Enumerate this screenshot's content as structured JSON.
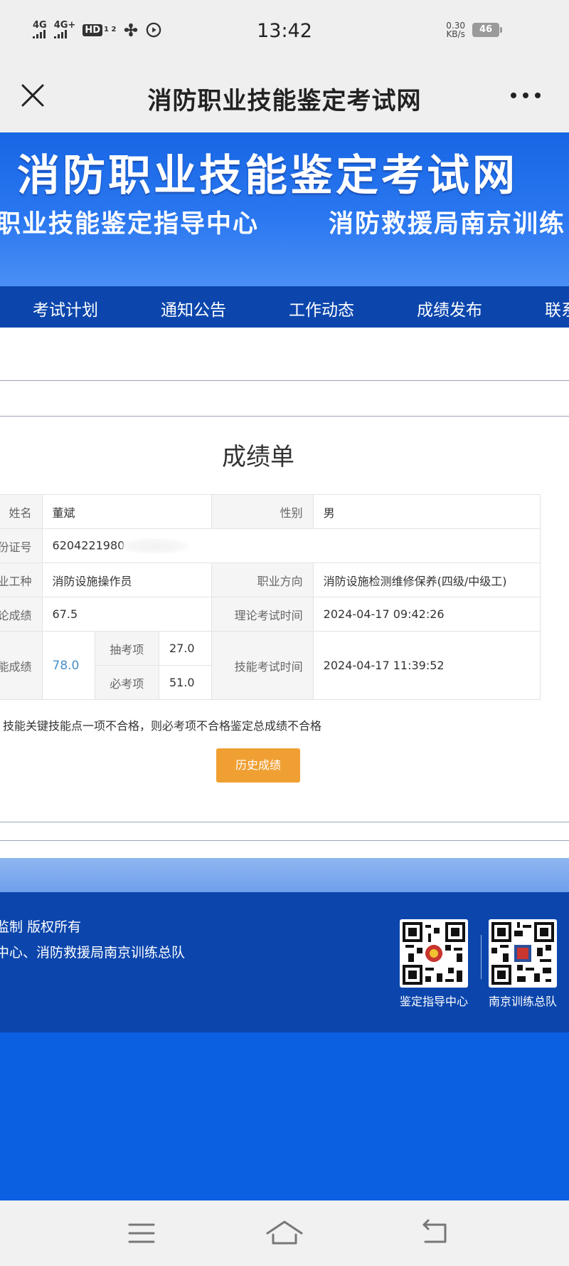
{
  "status_bar": {
    "sim1": "4G",
    "sim2": "4G+",
    "hd": "HD",
    "hd_sub": "1 2",
    "time": "13:42",
    "speed_value": "0.30",
    "speed_unit": "KB/s",
    "battery": "46"
  },
  "nav": {
    "title": "消防职业技能鉴定考试网"
  },
  "banner": {
    "title": "消防职业技能鉴定考试网",
    "sub_left": "职业技能鉴定指导中心",
    "sub_right": "消防救援局南京训练"
  },
  "menu": {
    "items": [
      "考试计划",
      "通知公告",
      "工作动态",
      "成绩发布",
      "联系"
    ]
  },
  "score": {
    "title": "成绩单",
    "rows": {
      "name_label": "姓名",
      "name_value": "董斌",
      "gender_label": "性别",
      "gender_value": "男",
      "id_label": "身份证号",
      "id_value": "6204221980",
      "job_label": "职业工种",
      "job_value": "消防设施操作员",
      "direction_label": "职业方向",
      "direction_value": "消防设施检测维修保养(四级/中级工)",
      "theory_label": "理论成绩",
      "theory_value": "67.5",
      "theory_time_label": "理论考试时间",
      "theory_time_value": "2024-04-17 09:42:26",
      "skill_label": "技能成绩",
      "skill_value": "78.0",
      "sample_label": "抽考项",
      "sample_value": "27.0",
      "required_label": "必考项",
      "required_value": "51.0",
      "skill_time_label": "技能考试时间",
      "skill_time_value": "2024-04-17 11:39:52"
    },
    "note": "技能关键技能点一项不合格，则必考项不合格鉴定总成绩不合格",
    "history_button": "历史成绩"
  },
  "footer": {
    "copyright": "监制 版权所有",
    "org": "中心、消防救援局南京训练总队",
    "qr1_caption": "鉴定指导中心",
    "qr2_caption": "南京训练总队"
  },
  "colors": {
    "banner_blue": "#1766e4",
    "menu_blue": "#0c46ad",
    "history_orange": "#f0a033",
    "skill_score_blue": "#4a8fc8"
  }
}
